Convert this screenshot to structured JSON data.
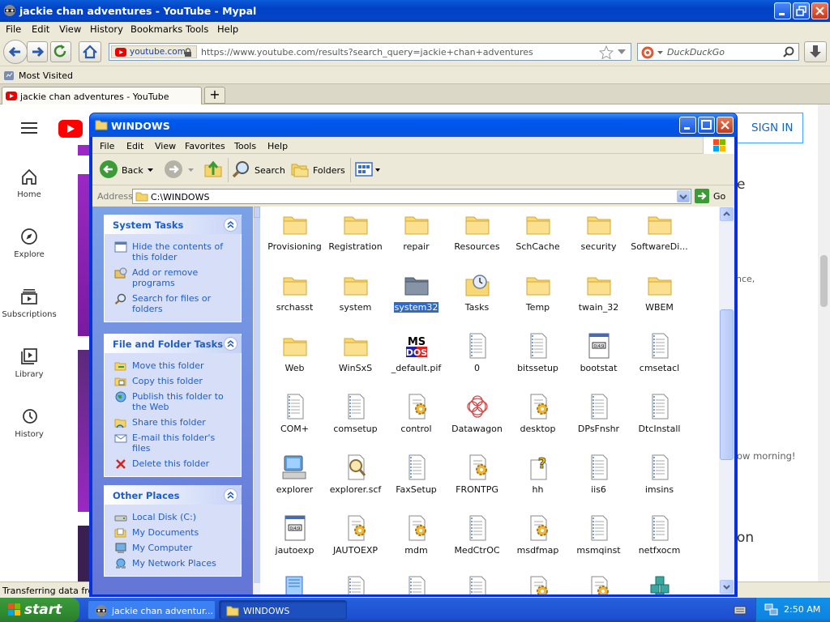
{
  "browser": {
    "title": "jackie chan adventures - YouTube - Mypal",
    "menu": [
      "File",
      "Edit",
      "View",
      "History",
      "Bookmarks",
      "Tools",
      "Help"
    ],
    "url_site": "youtube.com",
    "url": "https://www.youtube.com/results?search_query=jackie+chan+adventures",
    "search_placeholder": "DuckDuckGo",
    "bookmark": "Most Visited",
    "tab_title": "jackie chan adventures - YouTube",
    "new_tab": "+",
    "status": "Transferring data from"
  },
  "youtube": {
    "nav": [
      "Home",
      "Explore",
      "Subscriptions",
      "Library",
      "History"
    ],
    "sign_in": "SIGN IN",
    "fragments": [
      "e",
      "nce,",
      "ow morning!",
      "on"
    ]
  },
  "explorer": {
    "title": "WINDOWS",
    "menu": [
      "File",
      "Edit",
      "View",
      "Favorites",
      "Tools",
      "Help"
    ],
    "toolbar": {
      "back": "Back",
      "search": "Search",
      "folders": "Folders"
    },
    "address_label": "Address",
    "address": "C:\\WINDOWS",
    "go": "Go",
    "panels": [
      {
        "title": "System Tasks",
        "items": [
          "Hide the contents of this folder",
          "Add or remove programs",
          "Search for files or folders"
        ]
      },
      {
        "title": "File and Folder Tasks",
        "items": [
          "Move this folder",
          "Copy this folder",
          "Publish this folder to the Web",
          "Share this folder",
          "E-mail this folder's files",
          "Delete this folder"
        ]
      },
      {
        "title": "Other Places",
        "items": [
          "Local Disk (C:)",
          "My Documents",
          "My Computer",
          "My Network Places"
        ]
      }
    ],
    "files": [
      {
        "name": "Provisioning",
        "type": "folder"
      },
      {
        "name": "Registration",
        "type": "folder"
      },
      {
        "name": "repair",
        "type": "folder"
      },
      {
        "name": "Resources",
        "type": "folder"
      },
      {
        "name": "SchCache",
        "type": "folder"
      },
      {
        "name": "security",
        "type": "folder"
      },
      {
        "name": "SoftwareDi...",
        "type": "folder"
      },
      {
        "name": "srchasst",
        "type": "folder"
      },
      {
        "name": "system",
        "type": "folder"
      },
      {
        "name": "system32",
        "type": "folder-sel"
      },
      {
        "name": "Tasks",
        "type": "folder-tasks"
      },
      {
        "name": "Temp",
        "type": "folder"
      },
      {
        "name": "twain_32",
        "type": "folder"
      },
      {
        "name": "WBEM",
        "type": "folder"
      },
      {
        "name": "Web",
        "type": "folder"
      },
      {
        "name": "WinSxS",
        "type": "folder"
      },
      {
        "name": "_default.pif",
        "type": "msdos"
      },
      {
        "name": "0",
        "type": "doc"
      },
      {
        "name": "bitssetup",
        "type": "doc"
      },
      {
        "name": "bootstat",
        "type": "dat"
      },
      {
        "name": "cmsetacl",
        "type": "doc"
      },
      {
        "name": "COM+",
        "type": "doc"
      },
      {
        "name": "comsetup",
        "type": "doc"
      },
      {
        "name": "control",
        "type": "gear"
      },
      {
        "name": "Datawagon",
        "type": "flower"
      },
      {
        "name": "desktop",
        "type": "gear"
      },
      {
        "name": "DPsFnshr",
        "type": "doc"
      },
      {
        "name": "DtcInstall",
        "type": "doc"
      },
      {
        "name": "explorer",
        "type": "pc"
      },
      {
        "name": "explorer.scf",
        "type": "scf"
      },
      {
        "name": "FaxSetup",
        "type": "doc"
      },
      {
        "name": "FRONTPG",
        "type": "gear"
      },
      {
        "name": "hh",
        "type": "help"
      },
      {
        "name": "iis6",
        "type": "doc"
      },
      {
        "name": "imsins",
        "type": "doc"
      },
      {
        "name": "jautoexp",
        "type": "dat"
      },
      {
        "name": "JAUTOEXP",
        "type": "gear"
      },
      {
        "name": "mdm",
        "type": "gear"
      },
      {
        "name": "MedCtrOC",
        "type": "doc"
      },
      {
        "name": "msdfmap",
        "type": "gear"
      },
      {
        "name": "msmqinst",
        "type": "doc"
      },
      {
        "name": "netfxocm",
        "type": "doc"
      },
      {
        "name": "",
        "type": "blue"
      },
      {
        "name": "",
        "type": "doc"
      },
      {
        "name": "",
        "type": "doc"
      },
      {
        "name": "",
        "type": "doc"
      },
      {
        "name": "",
        "type": "gear"
      },
      {
        "name": "",
        "type": "gear"
      },
      {
        "name": "",
        "type": "cubes"
      }
    ]
  },
  "taskbar": {
    "start": "start",
    "items": [
      "jackie chan adventur...",
      "WINDOWS"
    ],
    "time": "2:50 AM"
  }
}
